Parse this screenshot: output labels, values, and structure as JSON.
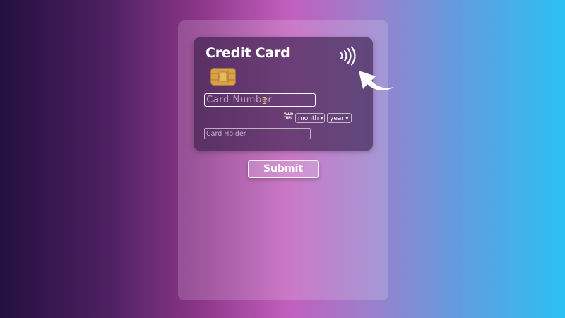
{
  "card": {
    "title": "Credit Card",
    "contactless_icon": "contactless-icon",
    "chip_icon": "chip-icon",
    "number_placeholder": "Card Number",
    "valid_thru_line1": "VALID",
    "valid_thru_line2": "THRU",
    "month_selected": "month",
    "year_selected": "year",
    "holder_placeholder": "Card Holder"
  },
  "form": {
    "submit_label": "Submit"
  },
  "decor": {
    "arrow_icon": "curved-arrow-icon",
    "cursor_icon": "text-cursor-icon"
  },
  "colors": {
    "accent_white": "#ffffff",
    "chip_gold": "#d9a24a"
  }
}
